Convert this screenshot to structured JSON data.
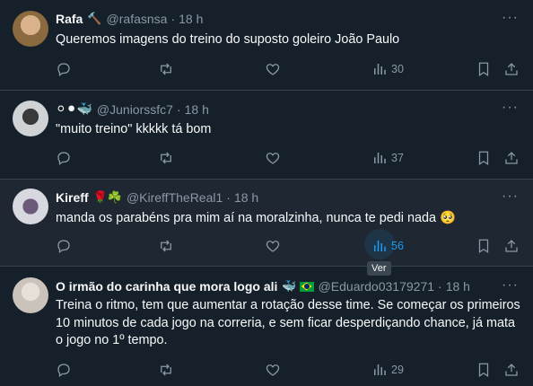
{
  "tweets": [
    {
      "name": "Rafa",
      "name_emoji": "🔨",
      "handle": "@rafasnsa",
      "time": "18 h",
      "text": "Queremos imagens do treino do suposto goleiro João Paulo",
      "views": "30"
    },
    {
      "name": "⚪⚫🐳",
      "name_emoji": "",
      "handle": "@Juniorssfc7",
      "time": "18 h",
      "text": "\"muito treino\" kkkkk tá bom",
      "views": "37"
    },
    {
      "name": "Kireff",
      "name_emoji": "🌹☘️",
      "handle": "@KireffTheReal1",
      "time": "18 h",
      "text": "manda os parabéns pra mim aí na moralzinha, nunca te pedi nada 🥺",
      "views": "56"
    },
    {
      "name": "O irmão do carinha que mora logo ali",
      "name_emoji": "🐳",
      "handle": "@Eduardo03179271",
      "time": "18 h",
      "text": "Treina o ritmo, tem que aumentar a rotação desse time. Se começar os primeiros 10 minutos de cada jogo na correria, e sem ficar desperdiçando chance, já mata o jogo no 1º tempo.",
      "views": "29"
    }
  ],
  "tooltip": "Ver",
  "more_glyph": "···",
  "dot": "·",
  "colors": {
    "background": "#15202b",
    "hover": "#1e2732",
    "accent": "#1d9bf0",
    "muted": "#8b98a5",
    "divider": "#38444d"
  }
}
